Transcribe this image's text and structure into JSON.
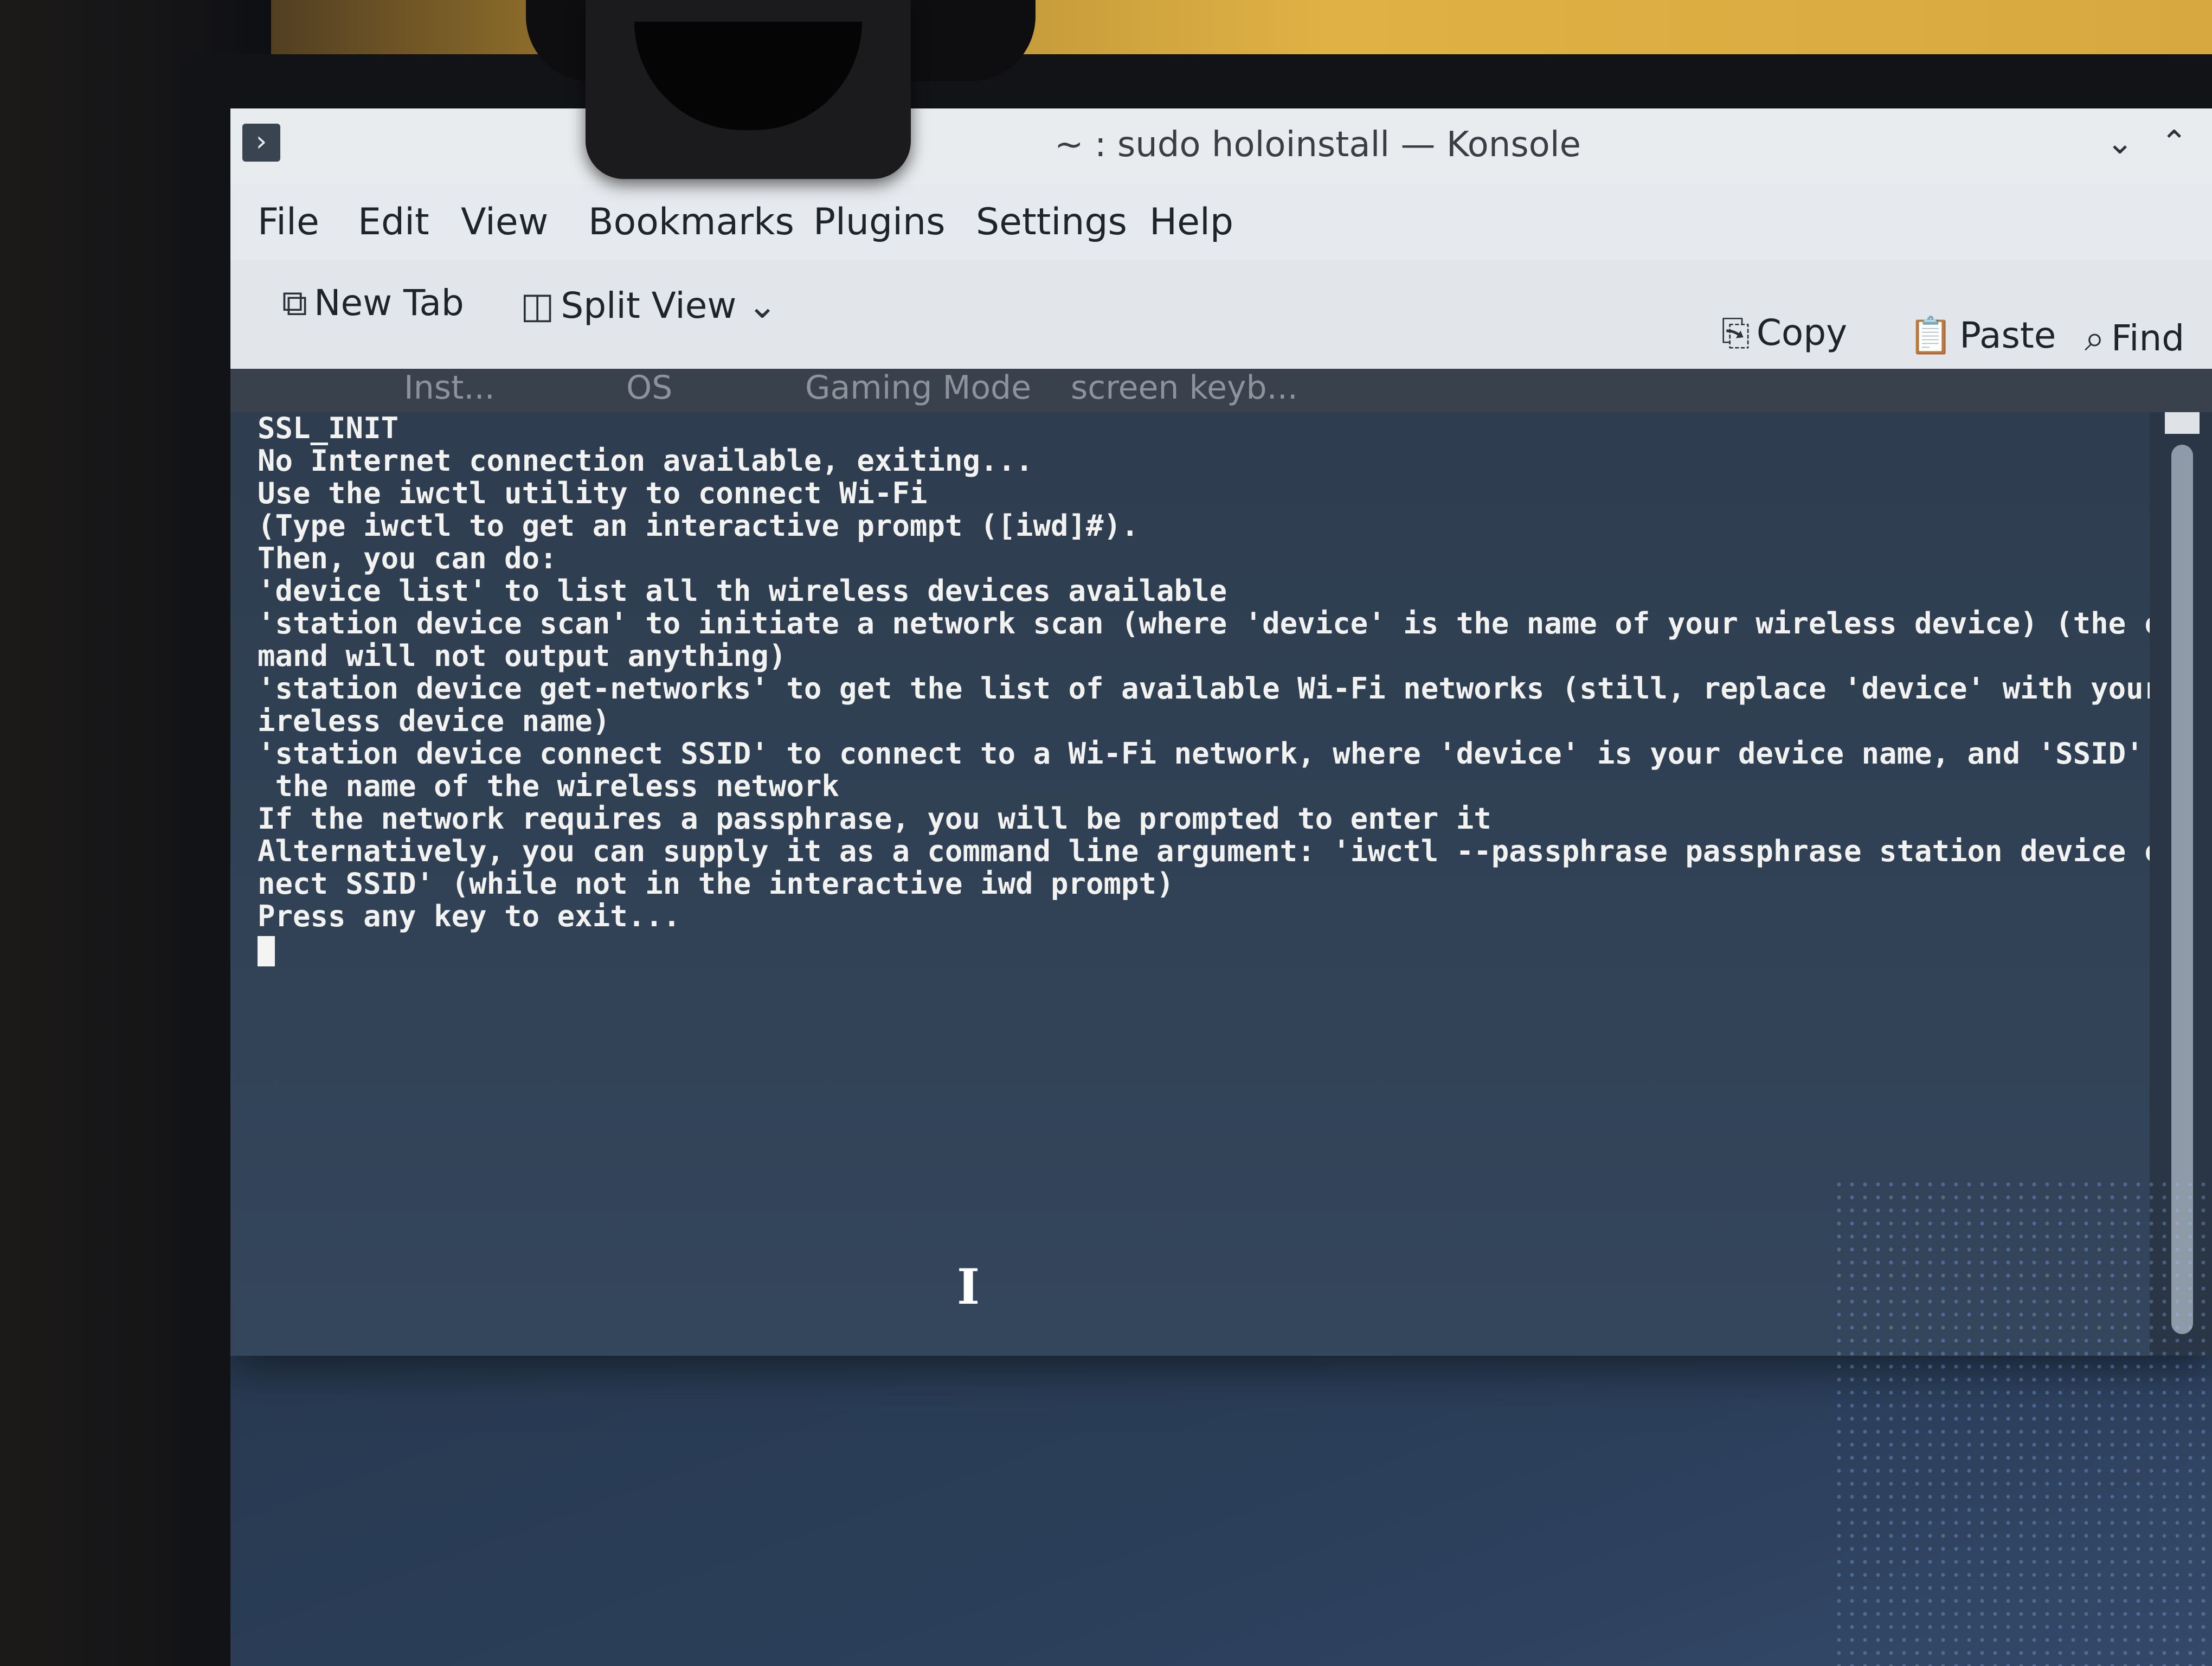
{
  "window": {
    "title": "~ : sudo holoinstall — Konsole",
    "app_icon": "terminal-prompt-icon",
    "controls": {
      "minimize": "chevron-down-icon",
      "maximize": "chevron-up-icon"
    }
  },
  "menubar": {
    "items": [
      "File",
      "Edit",
      "View",
      "Bookmarks",
      "Plugins",
      "Settings",
      "Help"
    ]
  },
  "toolbar": {
    "new_tab": "New Tab",
    "split_view": "Split View",
    "copy": "Copy",
    "paste": "Paste",
    "find": "Find"
  },
  "tabs": [
    "Inst...",
    "OS",
    "Gaming Mode",
    "screen keyb..."
  ],
  "terminal": {
    "lines": [
      "SSL_INIT",
      "No Internet connection available, exiting...",
      "Use the iwctl utility to connect Wi-Fi",
      "(Type iwctl to get an interactive prompt ([iwd]#).",
      "Then, you can do:",
      "'device list' to list all th wireless devices available",
      "'station device scan' to initiate a network scan (where 'device' is the name of your wireless device) (the com",
      "mand will not output anything)",
      "'station device get-networks' to get the list of available Wi-Fi networks (still, replace 'device' with your w",
      "ireless device name)",
      "'station device connect SSID' to connect to a Wi-Fi network, where 'device' is your device name, and 'SSID' is",
      " the name of the wireless network",
      "If the network requires a passphrase, you will be prompted to enter it",
      "Alternatively, you can supply it as a command line argument: 'iwctl --passphrase passphrase station device con",
      "nect SSID' (while not in the interactive iwd prompt)",
      "Press any key to exit..."
    ]
  },
  "colors": {
    "titlebar": "#e9ecef",
    "terminal_bg": "#2e3d4f",
    "terminal_fg": "#f2f2f0"
  }
}
